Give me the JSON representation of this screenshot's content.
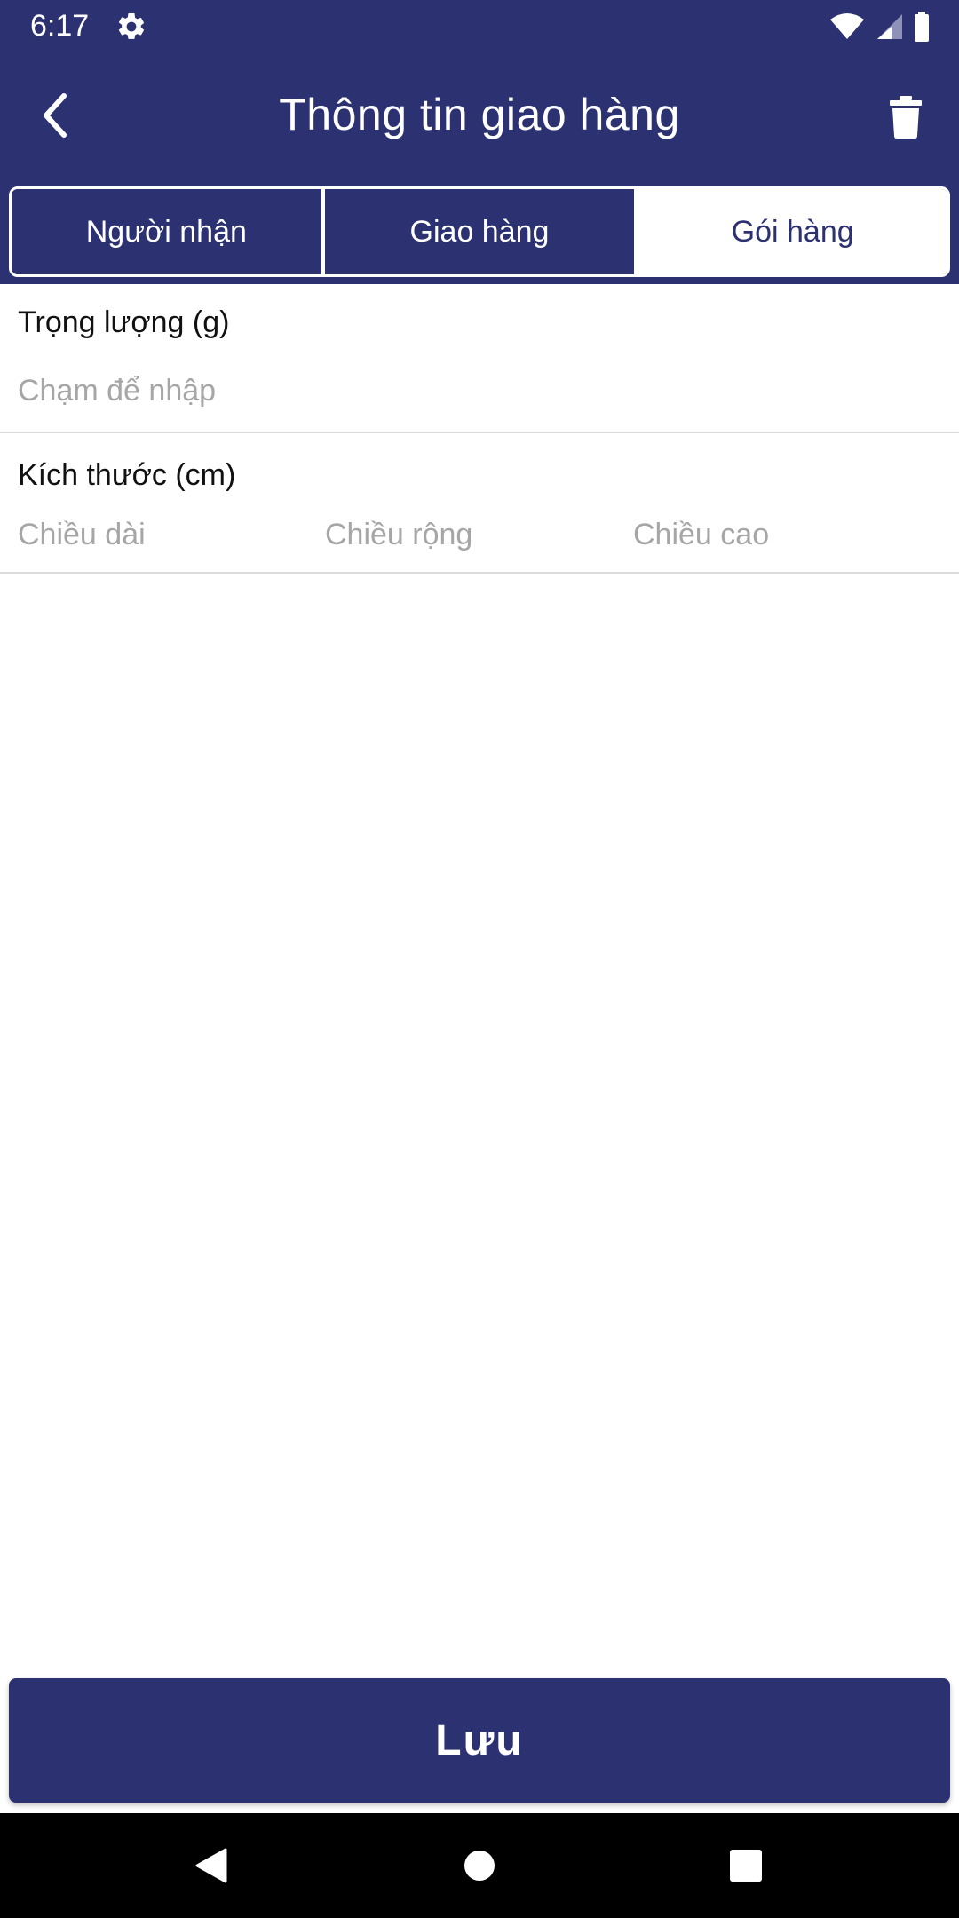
{
  "status_bar": {
    "time": "6:17",
    "icons": [
      "settings-icon",
      "wifi-icon",
      "signal-icon",
      "battery-icon"
    ]
  },
  "app_bar": {
    "title": "Thông tin giao hàng",
    "back_icon": "chevron-left-icon",
    "delete_icon": "trash-icon"
  },
  "tabs": [
    {
      "label": "Người nhận",
      "active": false
    },
    {
      "label": "Giao hàng",
      "active": false
    },
    {
      "label": "Gói hàng",
      "active": true
    }
  ],
  "form": {
    "weight": {
      "label": "Trọng lượng (g)",
      "value": "",
      "placeholder": "Chạm để nhập"
    },
    "size": {
      "label": "Kích thước (cm)",
      "length": {
        "value": "",
        "placeholder": "Chiều dài"
      },
      "width": {
        "value": "",
        "placeholder": "Chiều rộng"
      },
      "height": {
        "value": "",
        "placeholder": "Chiều cao"
      }
    }
  },
  "save_button": {
    "label": "Lưu"
  },
  "nav_bar": {
    "icons": [
      "nav-back-icon",
      "nav-home-icon",
      "nav-recents-icon"
    ]
  },
  "colors": {
    "primary": "#2c3172",
    "background": "#ffffff",
    "placeholder": "#a6a6a6",
    "divider": "#dcdcdc"
  }
}
